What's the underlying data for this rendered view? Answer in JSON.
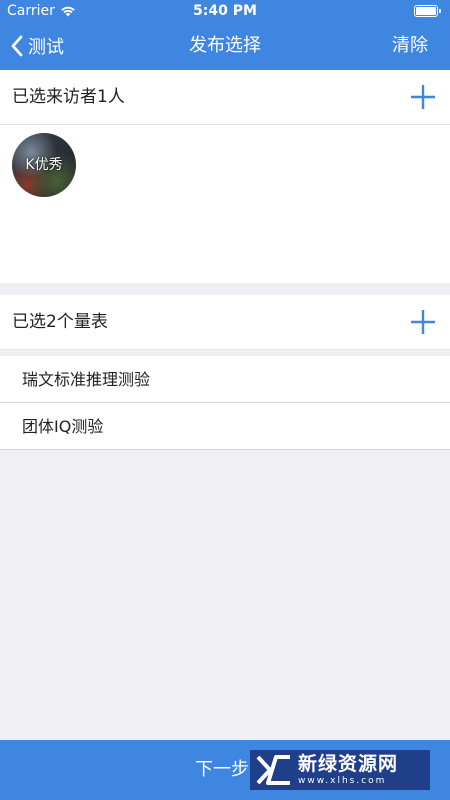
{
  "status_bar": {
    "carrier": "Carrier",
    "time": "5:40 PM"
  },
  "nav": {
    "back_label": "测试",
    "title": "发布选择",
    "clear_label": "清除"
  },
  "visitors": {
    "title": "已选来访者1人",
    "items": [
      {
        "name": "K优秀"
      }
    ]
  },
  "scales": {
    "title": "已选2个量表",
    "items": [
      {
        "label": "瑞文标准推理测验"
      },
      {
        "label": "团体IQ测验"
      }
    ]
  },
  "footer": {
    "next_label": "下一步"
  },
  "watermark": {
    "name": "新绿资源网",
    "url": "www.xlhs.com"
  },
  "colors": {
    "primary": "#3f86e0",
    "background": "#efeff4",
    "add_icon": "#3f86e0",
    "watermark_bg": "#1f3f8a"
  }
}
